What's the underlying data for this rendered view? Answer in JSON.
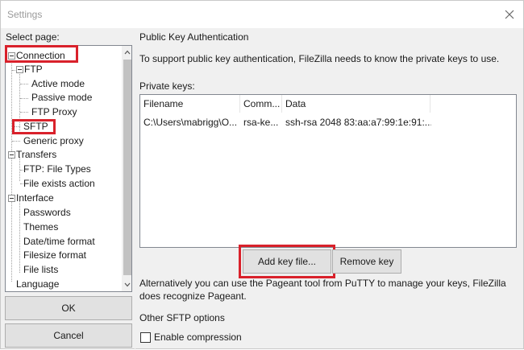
{
  "window": {
    "title": "Settings"
  },
  "sidebar": {
    "label": "Select page:",
    "tree": [
      "Connection",
      "FTP",
      "Active mode",
      "Passive mode",
      "FTP Proxy",
      "SFTP",
      "Generic proxy",
      "Transfers",
      "FTP: File Types",
      "File exists action",
      "Interface",
      "Passwords",
      "Themes",
      "Date/time format",
      "Filesize format",
      "File lists",
      "Language"
    ],
    "ok_label": "OK",
    "cancel_label": "Cancel"
  },
  "main": {
    "section_title": "Public Key Authentication",
    "description": "To support public key authentication, FileZilla needs to know the private keys to use.",
    "private_keys_label": "Private keys:",
    "columns": [
      "Filename",
      "Comm...",
      "Data"
    ],
    "rows": [
      {
        "filename": "C:\\Users\\mabrigg\\O...",
        "comment": "rsa-ke...",
        "data": "ssh-rsa 2048 83:aa:a7:99:1e:91:..."
      }
    ],
    "add_key_label": "Add key file...",
    "remove_key_label": "Remove key",
    "pageant_note": "Alternatively you can use the Pageant tool from PuTTY to manage your keys, FileZilla does recognize Pageant.",
    "other_options_title": "Other SFTP options",
    "enable_compression_label": "Enable compression",
    "enable_compression_checked": false
  },
  "colors": {
    "highlight": "#d9212b",
    "button_bg": "#e1e1e1",
    "window_bg": "#f0f0f0"
  }
}
